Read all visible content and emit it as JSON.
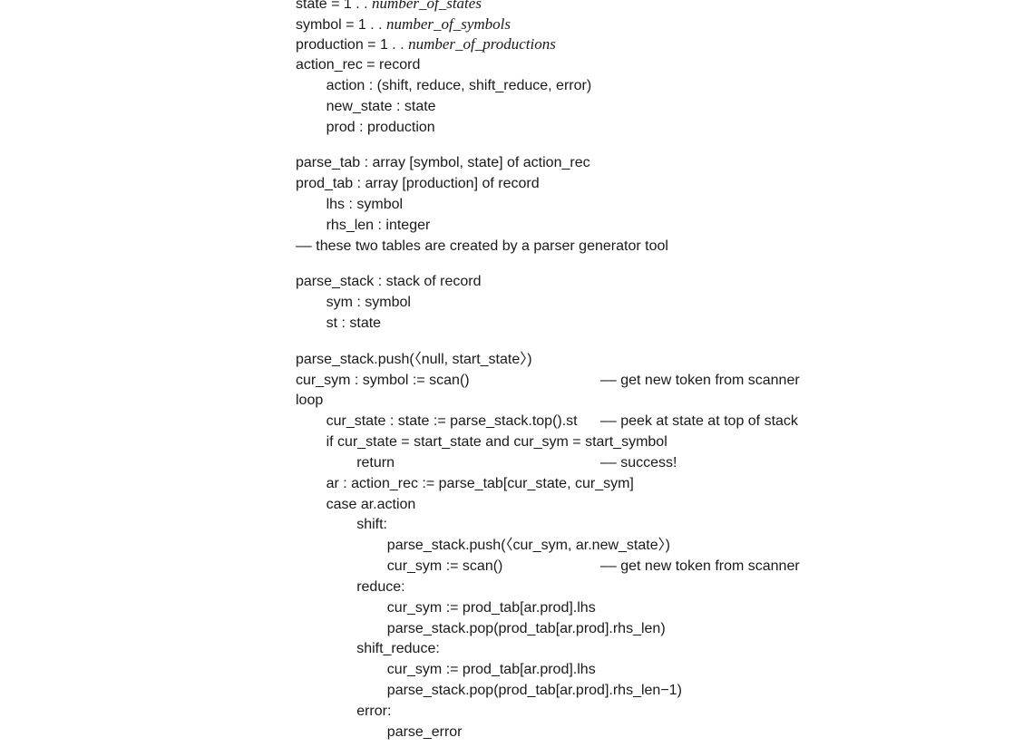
{
  "lines": [
    {
      "indent": 0,
      "text": "state = 1 . . ",
      "italic": "number_of_states",
      "comment": ""
    },
    {
      "indent": 0,
      "text": "symbol = 1 . . ",
      "italic": "number_of_symbols",
      "comment": ""
    },
    {
      "indent": 0,
      "text": "production = 1 . . ",
      "italic": "number_of_productions",
      "comment": ""
    },
    {
      "indent": 0,
      "text": "action_rec = record",
      "italic": "",
      "comment": ""
    },
    {
      "indent": 1,
      "text": "action : (shift, reduce, shift_reduce, error)",
      "italic": "",
      "comment": ""
    },
    {
      "indent": 1,
      "text": "new_state : state",
      "italic": "",
      "comment": ""
    },
    {
      "indent": 1,
      "text": "prod : production",
      "italic": "",
      "comment": ""
    },
    {
      "indent": 0,
      "text": "parse_tab : array [symbol, state] of action_rec",
      "italic": "",
      "comment": ""
    },
    {
      "indent": 0,
      "text": "prod_tab : array [production] of record",
      "italic": "",
      "comment": ""
    },
    {
      "indent": 1,
      "text": "lhs : symbol",
      "italic": "",
      "comment": ""
    },
    {
      "indent": 1,
      "text": "rhs_len : integer",
      "italic": "",
      "comment": ""
    },
    {
      "indent": 0,
      "text": "–– these two tables are created by a parser generator tool",
      "italic": "",
      "comment": ""
    },
    {
      "indent": 0,
      "text": "parse_stack : stack of record",
      "italic": "",
      "comment": ""
    },
    {
      "indent": 1,
      "text": "sym : symbol",
      "italic": "",
      "comment": ""
    },
    {
      "indent": 1,
      "text": "st : state",
      "italic": "",
      "comment": ""
    },
    {
      "indent": 0,
      "text": "parse_stack.push(〈null, start_state〉)",
      "italic": "",
      "comment": ""
    },
    {
      "indent": 0,
      "text": "cur_sym : symbol := scan()",
      "italic": "",
      "comment": "–– get new token from scanner"
    },
    {
      "indent": 0,
      "text": "loop",
      "italic": "",
      "comment": ""
    },
    {
      "indent": 1,
      "text": "cur_state : state := parse_stack.top().st",
      "italic": "",
      "comment": "–– peek at state at top of stack"
    },
    {
      "indent": 1,
      "text": "if cur_state = start_state and cur_sym = start_symbol",
      "italic": "",
      "comment": ""
    },
    {
      "indent": 2,
      "text": "return",
      "italic": "",
      "comment": "–– success!"
    },
    {
      "indent": 1,
      "text": "ar : action_rec := parse_tab[cur_state, cur_sym]",
      "italic": "",
      "comment": ""
    },
    {
      "indent": 1,
      "text": "case ar.action",
      "italic": "",
      "comment": ""
    },
    {
      "indent": 2,
      "text": "shift:",
      "italic": "",
      "comment": ""
    },
    {
      "indent": 3,
      "text": "parse_stack.push(〈cur_sym, ar.new_state〉)",
      "italic": "",
      "comment": ""
    },
    {
      "indent": 3,
      "text": "cur_sym := scan()",
      "italic": "",
      "comment": "–– get new token from scanner"
    },
    {
      "indent": 2,
      "text": "reduce:",
      "italic": "",
      "comment": ""
    },
    {
      "indent": 3,
      "text": "cur_sym := prod_tab[ar.prod].lhs",
      "italic": "",
      "comment": ""
    },
    {
      "indent": 3,
      "text": "parse_stack.pop(prod_tab[ar.prod].rhs_len)",
      "italic": "",
      "comment": ""
    },
    {
      "indent": 2,
      "text": "shift_reduce:",
      "italic": "",
      "comment": ""
    },
    {
      "indent": 3,
      "text": "cur_sym := prod_tab[ar.prod].lhs",
      "italic": "",
      "comment": ""
    },
    {
      "indent": 3,
      "text": "parse_stack.pop(prod_tab[ar.prod].rhs_len−1)",
      "italic": "",
      "comment": ""
    },
    {
      "indent": 2,
      "text": "error:",
      "italic": "",
      "comment": ""
    },
    {
      "indent": 3,
      "text": "parse_error",
      "italic": "",
      "comment": ""
    }
  ]
}
